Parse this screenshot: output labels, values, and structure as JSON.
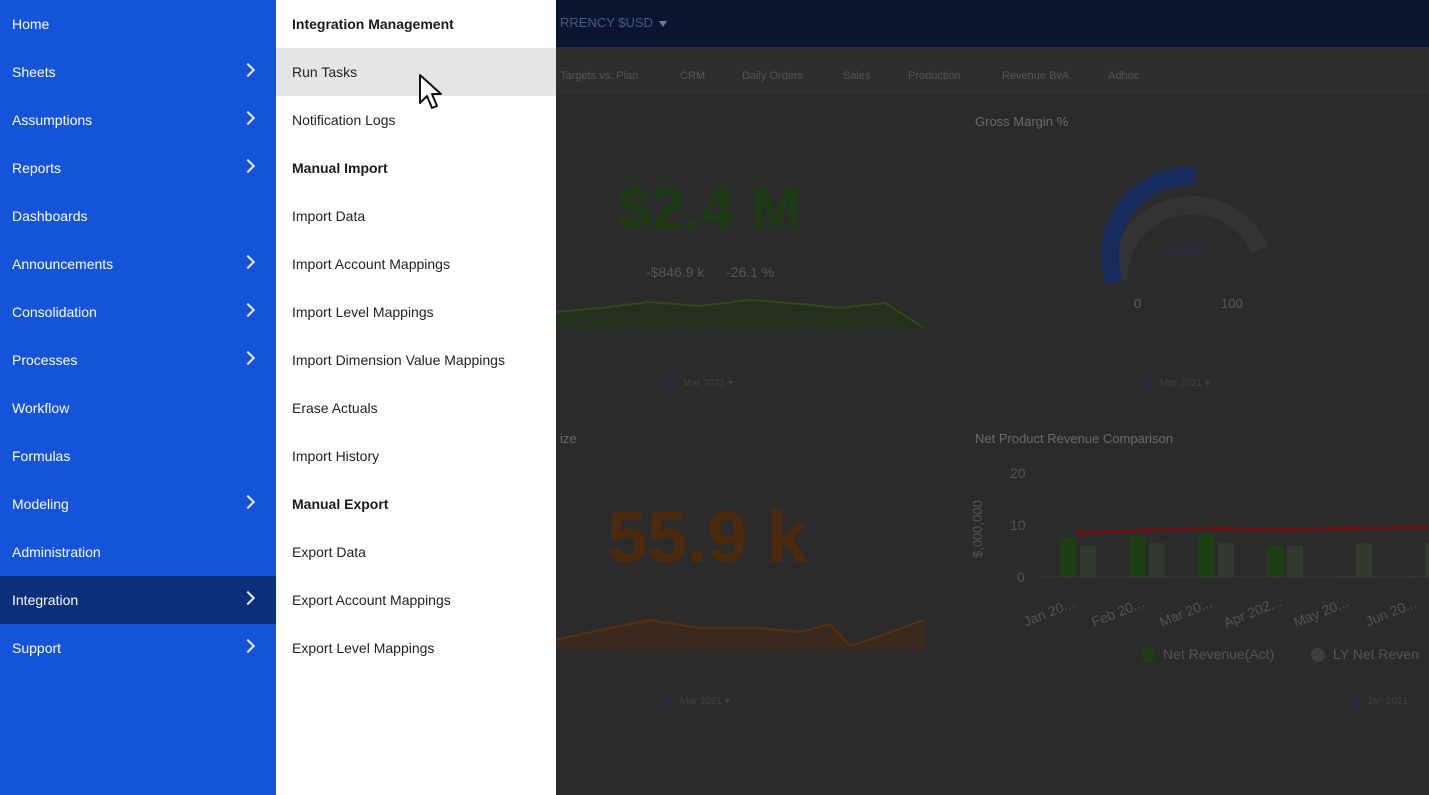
{
  "sidebar": {
    "items": [
      {
        "label": "Home",
        "has_submenu": false
      },
      {
        "label": "Sheets",
        "has_submenu": true
      },
      {
        "label": "Assumptions",
        "has_submenu": true
      },
      {
        "label": "Reports",
        "has_submenu": true
      },
      {
        "label": "Dashboards",
        "has_submenu": false
      },
      {
        "label": "Announcements",
        "has_submenu": true
      },
      {
        "label": "Consolidation",
        "has_submenu": true
      },
      {
        "label": "Processes",
        "has_submenu": true
      },
      {
        "label": "Workflow",
        "has_submenu": false
      },
      {
        "label": "Formulas",
        "has_submenu": false
      },
      {
        "label": "Modeling",
        "has_submenu": true
      },
      {
        "label": "Administration",
        "has_submenu": false
      },
      {
        "label": "Integration",
        "has_submenu": true,
        "active": true
      },
      {
        "label": "Support",
        "has_submenu": true
      }
    ]
  },
  "submenu": {
    "sections": [
      {
        "title": "Integration Management",
        "items": [
          "Run Tasks",
          "Notification Logs"
        ]
      },
      {
        "title": "Manual Import",
        "items": [
          "Import Data",
          "Import Account Mappings",
          "Import Level Mappings",
          "Import Dimension Value Mappings",
          "Erase Actuals",
          "Import History"
        ]
      },
      {
        "title": "Manual Export",
        "items": [
          "Export Data",
          "Export Account Mappings",
          "Export Level Mappings"
        ]
      }
    ],
    "hovered_item": "Run Tasks"
  },
  "dashboard": {
    "currency_label": "RRENCY $USD",
    "tabs": [
      "Targets vs. Plan",
      "CRM",
      "Daily Orders",
      "Sales",
      "Production",
      "Revenue BvA",
      "Adhoc"
    ],
    "revenue_tile": {
      "value": "$2.4 M",
      "delta_abs": "-$846.9 k",
      "delta_pct": "-26.1 %",
      "filter": "Mar 2021"
    },
    "gross_margin_tile": {
      "title": "Gross Margin %",
      "value": "53.2%",
      "min": "0",
      "max": "100",
      "filter": "Mar 2021"
    },
    "size_tile": {
      "title_fragment": "ize",
      "value": "55.9 k",
      "filter": "Mar 2021"
    },
    "comparison_tile": {
      "title": "Net Product Revenue Comparison",
      "filter": "Jan 2021"
    },
    "colors": {
      "sidebar": "#1553d8",
      "sidebar_active": "#0b2f78",
      "green_bar": "#1e3f14",
      "red_line": "#6b1010"
    }
  },
  "chart_data": {
    "type": "bar",
    "title": "Net Product Revenue Comparison",
    "ylabel": "$,000,000",
    "xlabel": "",
    "ylim": [
      0,
      20
    ],
    "yticks": [
      "0",
      "10",
      "20"
    ],
    "categories": [
      "Jan 20...",
      "Feb 20...",
      "Mar 20...",
      "Apr 202...",
      "May 20...",
      "Jun 20..."
    ],
    "series": [
      {
        "name": "Net Revenue(Act)",
        "type": "bar",
        "values": [
          7.5,
          8,
          8.5,
          6,
          0,
          0
        ]
      },
      {
        "name": "LY Net Reven",
        "type": "bar",
        "values": [
          6,
          6.5,
          6.5,
          6,
          6.5,
          6.5
        ]
      },
      {
        "type": "line",
        "values": [
          8.5,
          9,
          9.3,
          9,
          9.4,
          9.6
        ]
      }
    ],
    "legend_position": "bottom"
  }
}
